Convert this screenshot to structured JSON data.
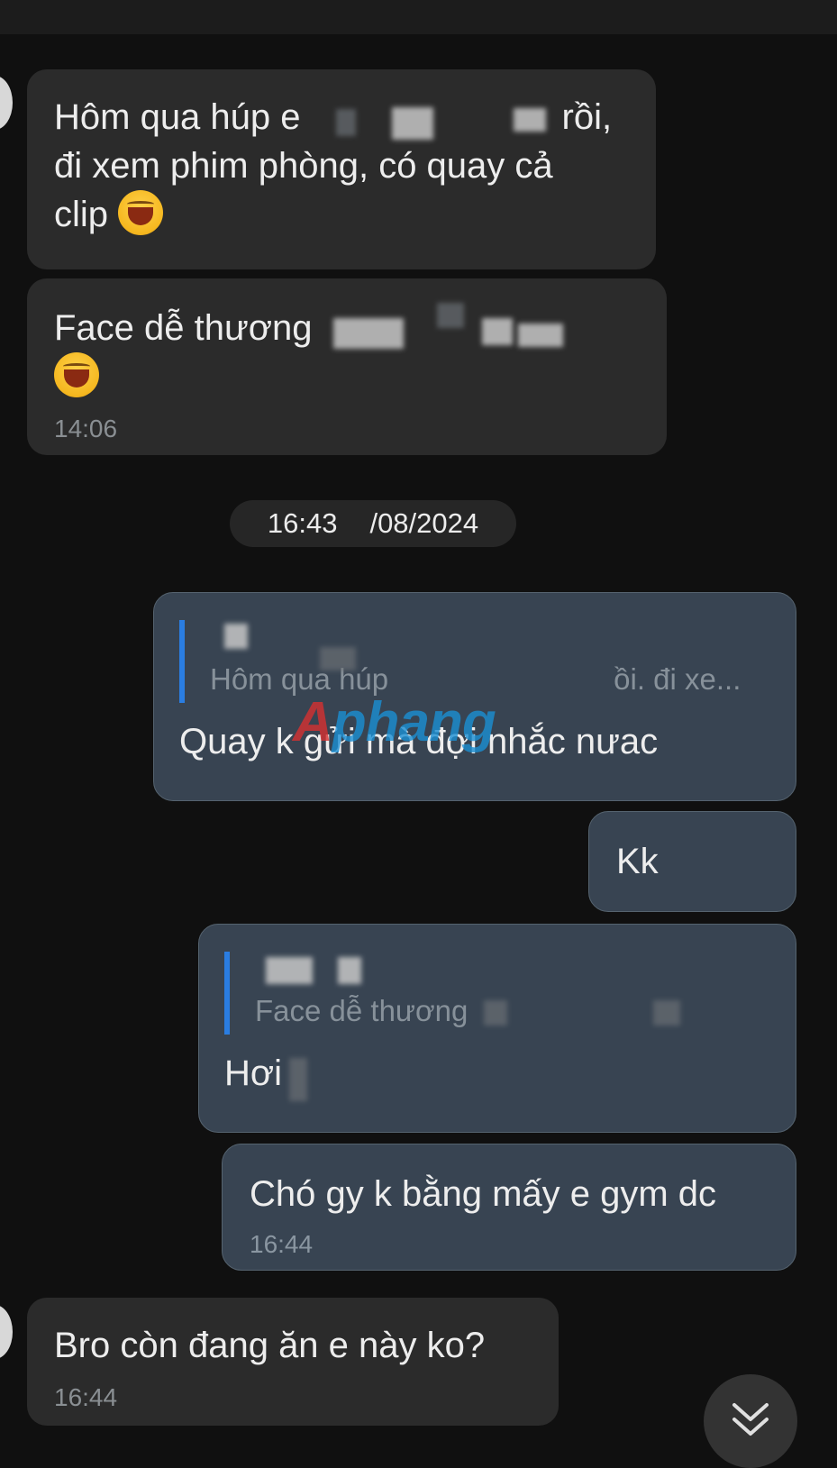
{
  "messages": [
    {
      "direction": "incoming",
      "text_lines": [
        "Hôm qua húp e",
        "rồi,",
        "đi xem phim phòng, có quay cả",
        "clip"
      ],
      "emoji": "laughing-crying-emoji"
    },
    {
      "direction": "incoming",
      "text": "Face dễ thương",
      "emoji": "laughing-crying-emoji",
      "time": "14:06"
    },
    {
      "direction": "outgoing",
      "reply_to": {
        "sender": "",
        "snippet": "Hôm qua húp",
        "snippet_end": "ồi. đi xe..."
      },
      "text": "Quay k gửi mà đợi nhắc nưac"
    },
    {
      "direction": "outgoing",
      "text": "Kk"
    },
    {
      "direction": "outgoing",
      "reply_to": {
        "sender": "",
        "snippet": "Face dễ thương"
      },
      "text": "Hơi"
    },
    {
      "direction": "outgoing",
      "text": "Chó gy k bằng mấy e gym dc",
      "time": "16:44"
    },
    {
      "direction": "incoming",
      "text": "Bro còn đang ăn e này ko?",
      "time": "16:44"
    }
  ],
  "date_separator": {
    "time": "16:43",
    "date": "/08/2024"
  },
  "watermark": {
    "prefix": "A",
    "text": "phang"
  },
  "scroll_button": {
    "icon": "double-chevron-down-icon"
  },
  "colors": {
    "background": "#101010",
    "incoming_bubble": "#2b2b2b",
    "outgoing_bubble": "#384452",
    "reply_accent": "#2a7de1"
  }
}
